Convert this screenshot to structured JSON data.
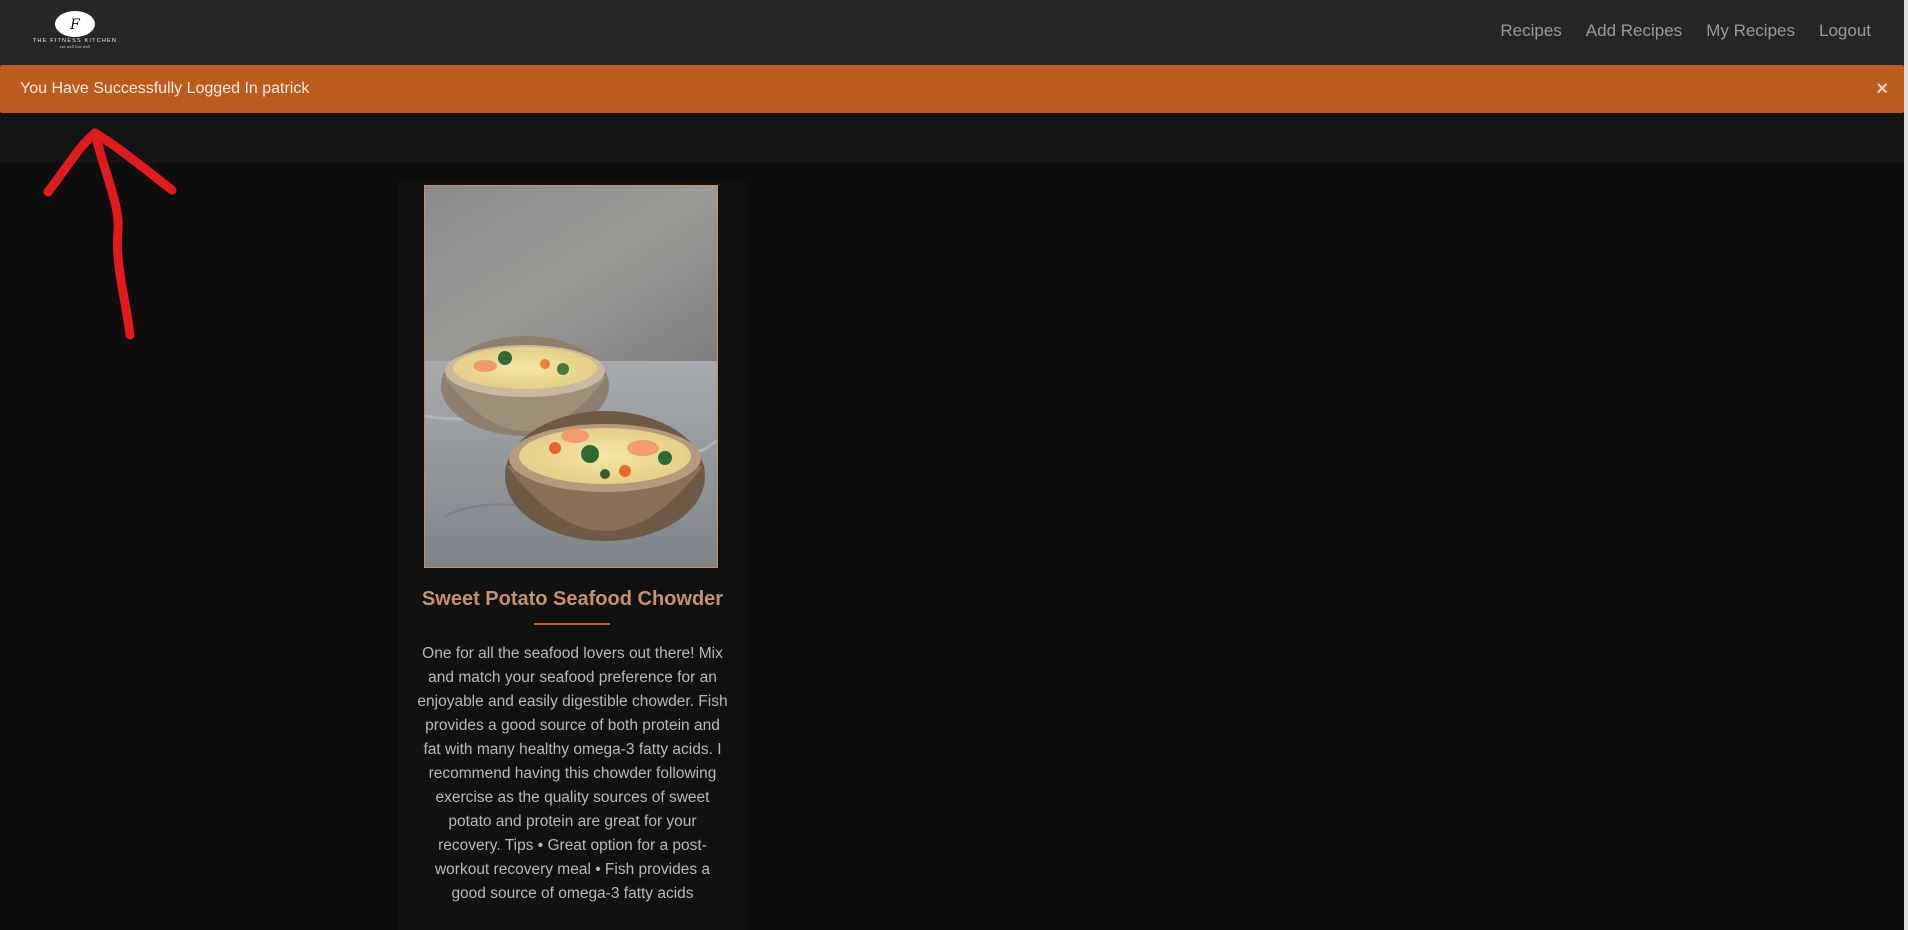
{
  "brand": {
    "logo_letter": "F",
    "logo_name": "THE FITNESS KITCHEN",
    "logo_tagline": "eat well live well"
  },
  "nav": {
    "items": [
      {
        "label": "Recipes"
      },
      {
        "label": "Add Recipes"
      },
      {
        "label": "My Recipes"
      },
      {
        "label": "Logout"
      }
    ]
  },
  "flash": {
    "message": "You Have Successfully Logged In patrick",
    "close_symbol": "×"
  },
  "recipe": {
    "title": "Sweet Potato Seafood Chowder",
    "description": "One for all the seafood lovers out there! Mix and match your seafood preference for an enjoyable and easily digestible chowder. Fish provides a good source of both protein and fat with many healthy omega-3 fatty acids. I recommend having this chowder following exercise as the quality sources of sweet potato and protein are great for your recovery. Tips • Great option for a post-workout recovery meal • Fish provides a good source of omega-3 fatty acids"
  },
  "colors": {
    "accent": "#bc5b1e",
    "navbar": "#262626",
    "background": "#0d0d0d",
    "title": "#c8906c",
    "annotation": "#e11b1b"
  }
}
